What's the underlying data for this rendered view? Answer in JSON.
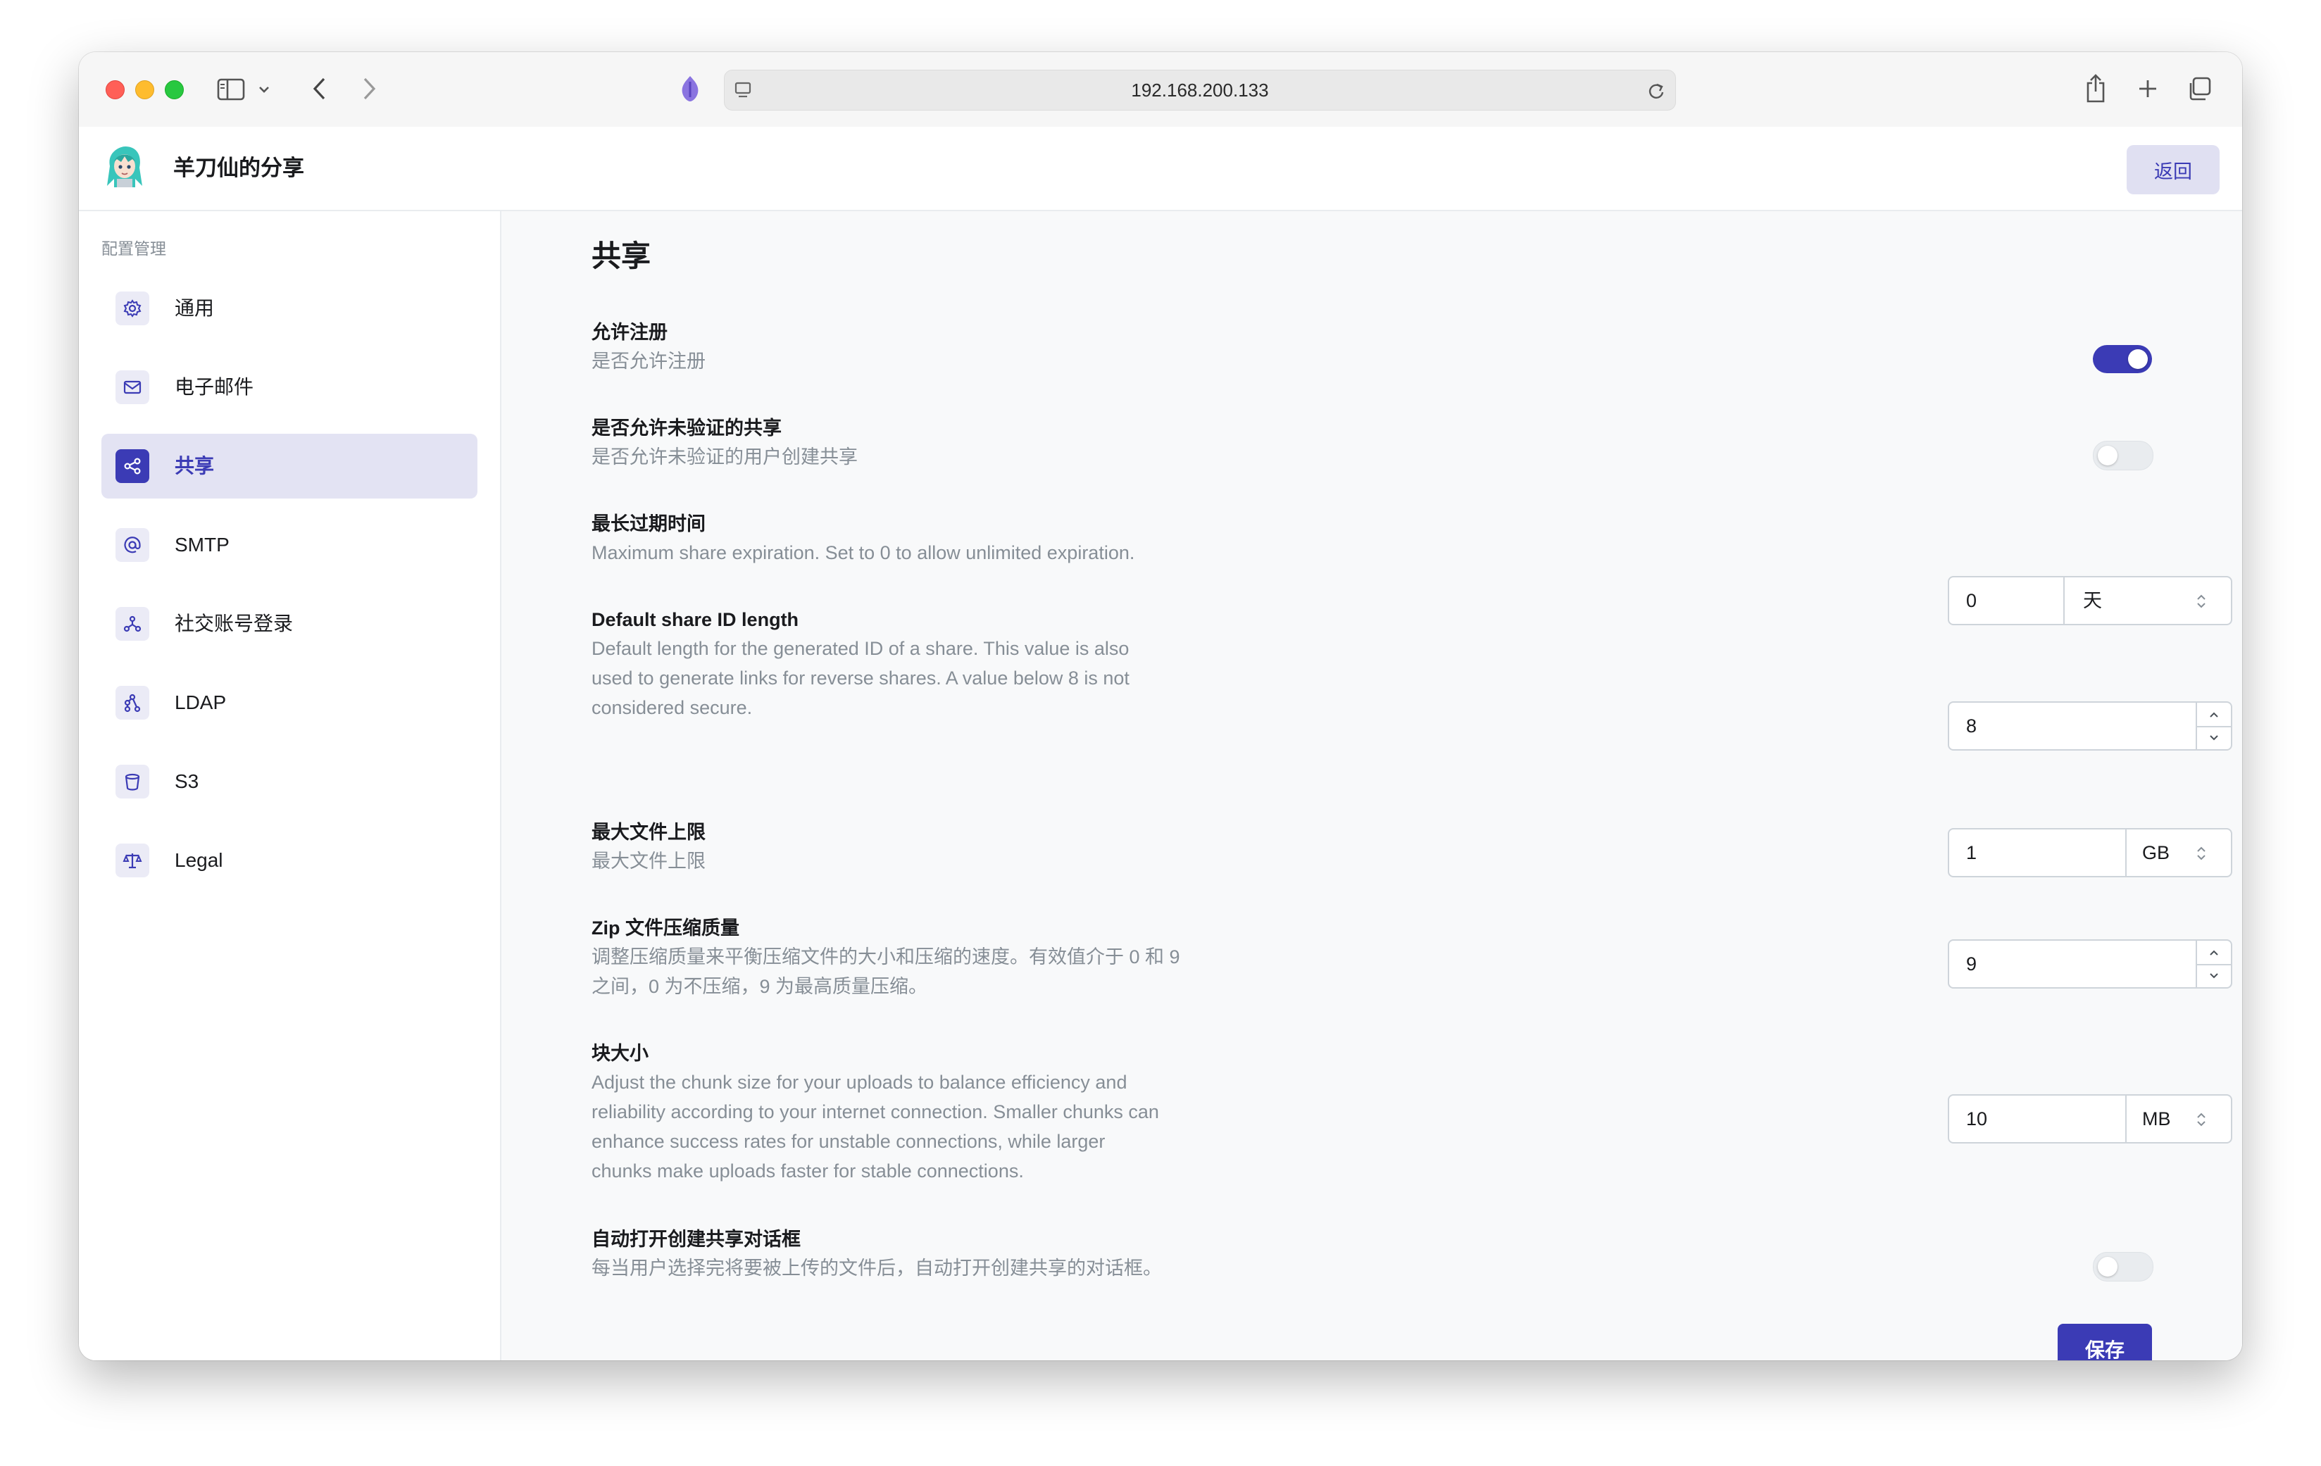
{
  "browser": {
    "url": "192.168.200.133"
  },
  "header": {
    "title": "羊刀仙的分享",
    "back_label": "返回"
  },
  "sidebar": {
    "section_label": "配置管理",
    "items": [
      {
        "label": "通用",
        "icon": "gear-icon"
      },
      {
        "label": "电子邮件",
        "icon": "mail-icon"
      },
      {
        "label": "共享",
        "icon": "share-icon",
        "active": true
      },
      {
        "label": "SMTP",
        "icon": "at-icon"
      },
      {
        "label": "社交账号登录",
        "icon": "social-icon"
      },
      {
        "label": "LDAP",
        "icon": "ldap-icon"
      },
      {
        "label": "S3",
        "icon": "bucket-icon"
      },
      {
        "label": "Legal",
        "icon": "scale-icon"
      }
    ]
  },
  "main": {
    "title": "共享",
    "settings": {
      "allow_registration": {
        "title": "允许注册",
        "desc": "是否允许注册",
        "enabled": true
      },
      "allow_unauth_shares": {
        "title": "是否允许未验证的共享",
        "desc": "是否允许未验证的用户创建共享",
        "enabled": false
      },
      "max_expiration": {
        "title": "最长过期时间",
        "desc": "Maximum share expiration. Set to 0 to allow unlimited expiration.",
        "value": "0",
        "unit": "天"
      },
      "share_id_length": {
        "title": "Default share ID length",
        "desc_lines": [
          "Default length for the generated ID of a share. This value is also",
          "used to generate links for reverse shares. A value below 8 is not",
          "considered secure."
        ],
        "value": "8"
      },
      "max_size": {
        "title": "最大文件上限",
        "desc": "最大文件上限",
        "value": "1",
        "unit": "GB"
      },
      "zip_level": {
        "title": "Zip 文件压缩质量",
        "desc_lines": [
          "调整压缩质量来平衡压缩文件的大小和压缩的速度。有效值介于 0 和 9",
          "之间，0 为不压缩，9 为最高质量压缩。"
        ],
        "value": "9"
      },
      "chunk_size": {
        "title": "块大小",
        "desc_lines": [
          "Adjust the chunk size for your uploads to balance efficiency and",
          "reliability according to your internet connection. Smaller chunks can",
          "enhance success rates for unstable connections, while larger",
          "chunks make uploads faster for stable connections."
        ],
        "value": "10",
        "unit": "MB"
      },
      "auto_open_dialog": {
        "title": "自动打开创建共享对话框",
        "desc": "每当用户选择完将要被上传的文件后，自动打开创建共享的对话框。",
        "enabled": false
      }
    },
    "save_label": "保存"
  },
  "colors": {
    "accent": "#3b3bb5",
    "accent_light": "#e3e3f3"
  }
}
